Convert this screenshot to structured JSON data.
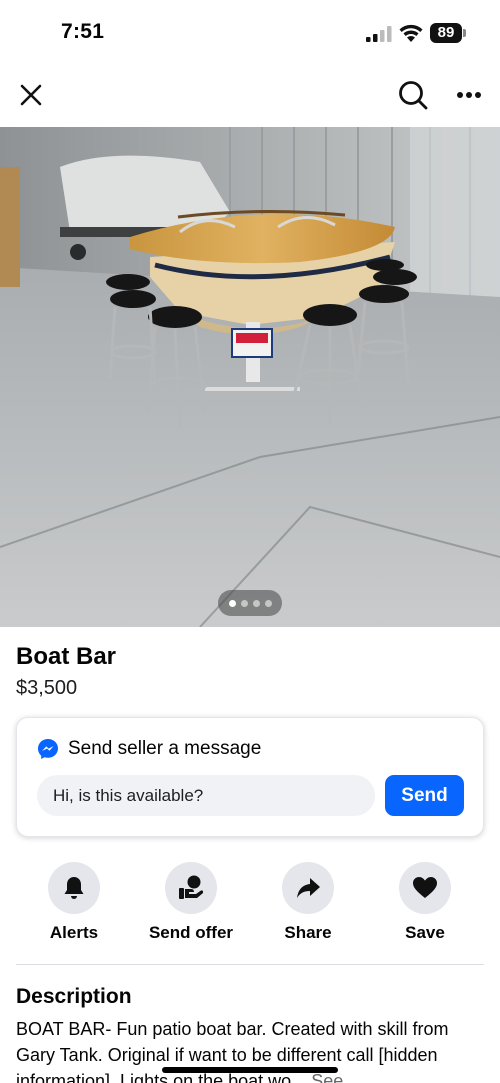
{
  "status": {
    "time": "7:51",
    "battery": "89"
  },
  "nav": {
    "close_icon": "close-icon",
    "search_icon": "search-icon",
    "more_icon": "more-icon"
  },
  "photo": {
    "pager_total": 4,
    "pager_active": 1
  },
  "listing": {
    "title": "Boat Bar",
    "price": "$3,500"
  },
  "message": {
    "heading": "Send seller a message",
    "input_value": "Hi, is this available?",
    "send_label": "Send",
    "accent": "#0866ff"
  },
  "actions": [
    {
      "label": "Alerts",
      "icon": "bell-icon"
    },
    {
      "label": "Send offer",
      "icon": "offer-icon"
    },
    {
      "label": "Share",
      "icon": "share-icon"
    },
    {
      "label": "Save",
      "icon": "heart-icon"
    }
  ],
  "description": {
    "heading": "Description",
    "text": "BOAT BAR- Fun patio boat bar.  Created with skill from Gary Tank. Original if want to be different call [hidden information]. Lights on the boat wo...",
    "see_more": "See"
  }
}
